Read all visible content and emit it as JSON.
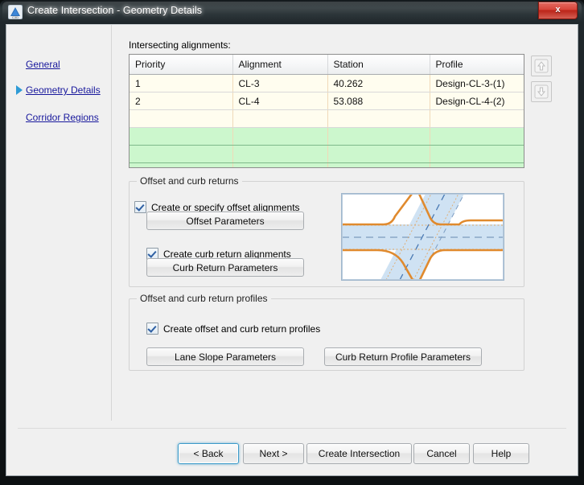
{
  "window": {
    "title": "Create Intersection - Geometry Details",
    "app_icon": "autocad-civil3d-icon",
    "close_label": "x"
  },
  "sidebar": {
    "items": [
      {
        "label": "General",
        "selected": false
      },
      {
        "label": "Geometry Details",
        "selected": true
      },
      {
        "label": "Corridor Regions",
        "selected": false
      }
    ],
    "selected_marker_icon": "triangle-right-icon"
  },
  "main": {
    "intersecting_label": "Intersecting alignments:",
    "table": {
      "columns": [
        "Priority",
        "Alignment",
        "Station",
        "Profile"
      ],
      "rows": [
        [
          "1",
          "CL-3",
          "40.262",
          "Design-CL-3-(1)"
        ],
        [
          "2",
          "CL-4",
          "53.088",
          "Design-CL-4-(2)"
        ]
      ],
      "empty_cream_rows": 1,
      "empty_green_rows": 3
    },
    "side_buttons": [
      {
        "name": "move-up-button",
        "icon": "arrow-up-icon",
        "enabled": false
      },
      {
        "name": "move-down-button",
        "icon": "arrow-down-icon",
        "enabled": false
      }
    ],
    "offset_group": {
      "legend": "Offset and curb returns",
      "checkbox_offset_alignments": {
        "label": "Create or specify offset alignments",
        "checked": true
      },
      "button_offset_parameters": "Offset Parameters",
      "checkbox_curb_return_alignments": {
        "label": "Create curb return alignments",
        "checked": true
      },
      "button_curb_return_parameters": "Curb Return Parameters",
      "preview_icon": "intersection-preview-diagram"
    },
    "profiles_group": {
      "legend": "Offset and curb return profiles",
      "checkbox_profiles": {
        "label": "Create offset and curb return profiles",
        "checked": true
      },
      "button_lane_slope_parameters": "Lane Slope Parameters",
      "button_curb_return_profile_parameters": "Curb Return Profile Parameters"
    }
  },
  "footer": {
    "back": "< Back",
    "next": "Next >",
    "create": "Create Intersection",
    "cancel": "Cancel",
    "help": "Help"
  },
  "colors": {
    "accent_link": "#17179c",
    "marker": "#2e9bd6",
    "row_cream": "#fffdef",
    "row_green": "#ccf7cd",
    "road_orange": "#e08a2e",
    "corridor_blue": "#cfe2f3"
  }
}
